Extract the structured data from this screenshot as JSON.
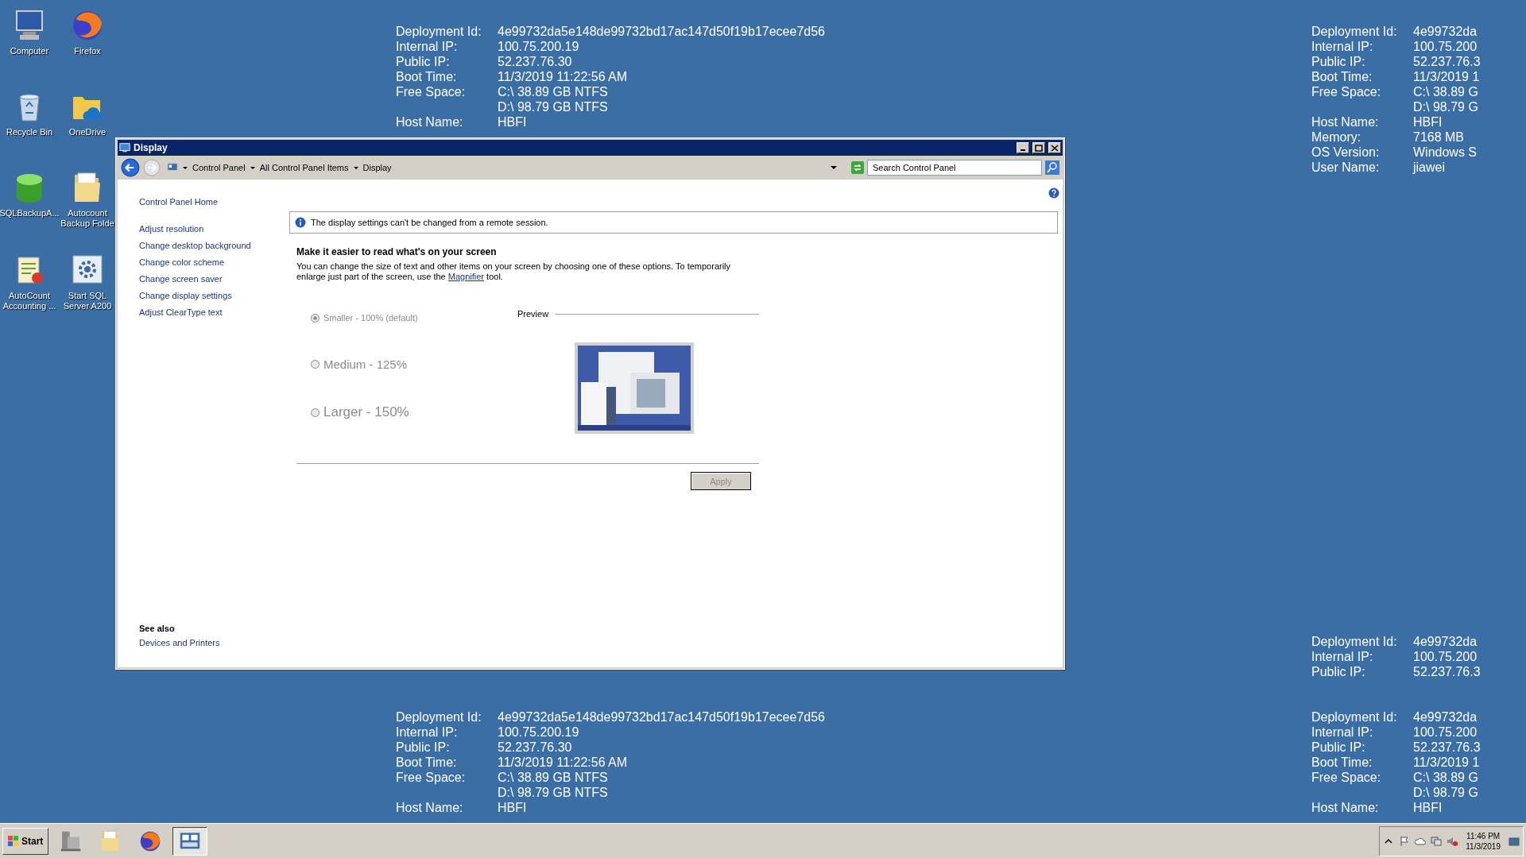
{
  "desktop_icons": [
    {
      "label": "Computer",
      "kind": "computer"
    },
    {
      "label": "Firefox",
      "kind": "browser"
    },
    {
      "label": "Recycle Bin",
      "kind": "bin"
    },
    {
      "label": "OneDrive",
      "kind": "cloud-folder"
    },
    {
      "label": "SQLBackupA...",
      "kind": "database"
    },
    {
      "label": "Autocount Backup Folde",
      "kind": "folder"
    },
    {
      "label": "AutoCount Accounting ...",
      "kind": "app"
    },
    {
      "label": "Start SQL Server A200",
      "kind": "gear"
    }
  ],
  "info_blocks": [
    {
      "rows": [
        {
          "label": "Deployment Id:",
          "value": "4e99732da5e148de99732bd17ac147d50f19b17ecee7d56"
        },
        {
          "label": "Internal IP:",
          "value": "100.75.200.19"
        },
        {
          "label": "Public IP:",
          "value": "52.237.76.30"
        },
        {
          "label": "Boot Time:",
          "value": "11/3/2019 11:22:56 AM"
        },
        {
          "label": "Free Space:",
          "value": "C:\\ 38.89 GB NTFS"
        },
        {
          "value": "D:\\ 98.79 GB NTFS"
        },
        {
          "label": "Host Name:",
          "value": "HBFI"
        }
      ]
    },
    {
      "rows": [
        {
          "label": "Deployment Id:",
          "value": "4e99732da"
        },
        {
          "label": "Internal IP:",
          "value": "100.75.200"
        },
        {
          "label": "Public IP:",
          "value": "52.237.76.3"
        },
        {
          "label": "Boot Time:",
          "value": "11/3/2019 1"
        },
        {
          "label": "Free Space:",
          "value": "C:\\ 38.89 G"
        },
        {
          "value": "D:\\ 98.79 G"
        },
        {
          "label": "Host Name:",
          "value": "HBFI"
        },
        {
          "label": "Memory:",
          "value": "7168 MB"
        },
        {
          "label": "OS Version:",
          "value": "Windows S"
        },
        {
          "label": "User Name:",
          "value": "jiawei"
        }
      ]
    },
    {
      "rows": [
        {
          "label": "Deployment Id:",
          "value": "4e99732da5e148de99732bd17ac147d50f19b17ecee7d56"
        },
        {
          "label": "Internal IP:",
          "value": "100.75.200.19"
        },
        {
          "label": "Public IP:",
          "value": "52.237.76.30"
        },
        {
          "label": "Boot Time:",
          "value": "11/3/2019 11:22:56 AM"
        },
        {
          "label": "Free Space:",
          "value": "C:\\ 38.89 GB NTFS"
        },
        {
          "value": "D:\\ 98.79 GB NTFS"
        },
        {
          "label": "Host Name:",
          "value": "HBFI"
        }
      ]
    },
    {
      "rows": [
        {
          "label": "Deployment Id:",
          "value": "4e99732da"
        },
        {
          "label": "Internal IP:",
          "value": "100.75.200"
        },
        {
          "label": "Public IP:",
          "value": "52.237.76.3"
        }
      ]
    },
    {
      "rows": [
        {
          "label": "Deployment Id:",
          "value": "4e99732da"
        },
        {
          "label": "Internal IP:",
          "value": "100.75.200"
        },
        {
          "label": "Public IP:",
          "value": "52.237.76.3"
        },
        {
          "label": "Boot Time:",
          "value": "11/3/2019 1"
        },
        {
          "label": "Free Space:",
          "value": "C:\\ 38.89 G"
        },
        {
          "value": "D:\\ 98.79 G"
        },
        {
          "label": "Host Name:",
          "value": "HBFI"
        }
      ]
    }
  ],
  "window": {
    "title": "Display",
    "breadcrumb": [
      "Control Panel",
      "All Control Panel Items",
      "Display"
    ],
    "search": {
      "placeholder": "Search Control Panel"
    },
    "sidebar": {
      "home": "Control Panel Home",
      "links": [
        "Adjust resolution",
        "Change desktop background",
        "Change color scheme",
        "Change screen saver",
        "Change display settings",
        "Adjust ClearType text"
      ],
      "see_also_heading": "See also",
      "see_also_links": [
        "Devices and Printers"
      ]
    },
    "notice": "The display settings can't be changed from a remote session.",
    "heading": "Make it easier to read what's on your screen",
    "description": {
      "before": "You can change the size of text and other items on your screen by choosing one of these options. To temporarily enlarge just part of the screen, use the ",
      "link": "Magnifier",
      "after": " tool."
    },
    "options": [
      {
        "label": "Smaller - 100% (default)",
        "selected": true,
        "disabled": true
      },
      {
        "label": "Medium - 125%",
        "selected": false,
        "disabled": true
      },
      {
        "label": "Larger - 150%",
        "selected": false,
        "disabled": true
      }
    ],
    "preview_label": "Preview",
    "apply_button": {
      "label": "Apply",
      "disabled": true
    }
  },
  "taskbar": {
    "start": "Start",
    "apps": [
      {
        "kind": "server",
        "active": false
      },
      {
        "kind": "folder",
        "active": false
      },
      {
        "kind": "browser",
        "active": false
      },
      {
        "kind": "control-panel",
        "active": true
      }
    ],
    "time": "11:46 PM",
    "date": "11/3/2019"
  }
}
